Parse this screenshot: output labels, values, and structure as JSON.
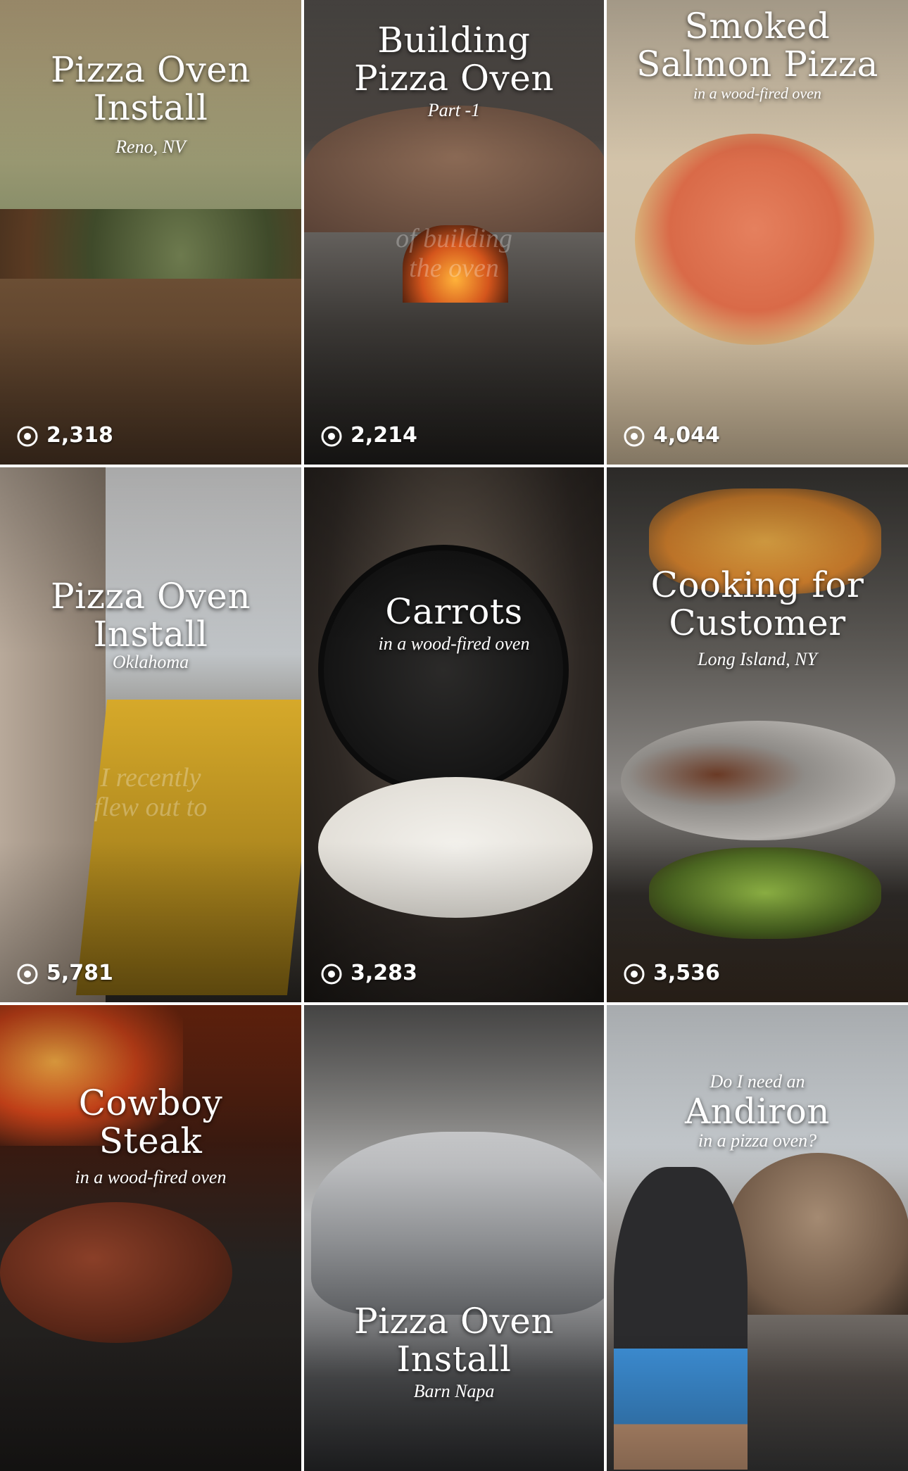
{
  "grid": {
    "tiles": [
      {
        "title": "Pizza Oven\nInstall",
        "subtitle": "Reno, NV",
        "ghost": "",
        "views": "2,318"
      },
      {
        "title": "Building\nPizza Oven",
        "subtitle": "Part -1",
        "ghost": "of building\nthe oven",
        "views": "2,214"
      },
      {
        "title": "Smoked\nSalmon Pizza",
        "subtitle": "in a wood-fired oven",
        "ghost": "",
        "views": "4,044"
      },
      {
        "title": "Pizza Oven\nInstall",
        "subtitle": "Oklahoma",
        "ghost": "I recently\nflew out to",
        "views": "5,781"
      },
      {
        "title": "Carrots",
        "subtitle": "in a wood-fired oven",
        "ghost": "",
        "views": "3,283"
      },
      {
        "title": "Cooking for\nCustomer",
        "subtitle": "Long Island, NY",
        "ghost": "",
        "views": "3,536"
      },
      {
        "title": "Cowboy\nSteak",
        "subtitle": "in a wood-fired oven",
        "ghost": "",
        "views": ""
      },
      {
        "title": "Pizza Oven\nInstall",
        "subtitle": "Barn Napa",
        "ghost": "",
        "views": ""
      },
      {
        "title": "Andiron",
        "pretitle": "Do I need an",
        "subtitle": "in a pizza oven?",
        "ghost": "",
        "views": ""
      }
    ]
  },
  "icons": {
    "views": "eye-icon"
  },
  "colors": {
    "text": "#ffffff",
    "divider": "#ffffff"
  }
}
